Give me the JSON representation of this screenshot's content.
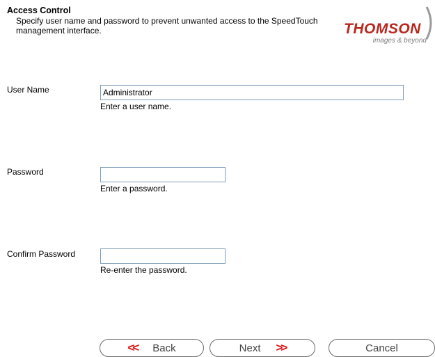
{
  "header": {
    "title": "Access Control",
    "description": "Specify user name and password to prevent unwanted access to the SpeedTouch management interface."
  },
  "logo": {
    "brand": "THOMSON",
    "tagline": "images & beyond",
    "brand_color": "#b8271e"
  },
  "fields": {
    "username": {
      "label": "User Name",
      "value": "Administrator",
      "hint": "Enter a user name."
    },
    "password": {
      "label": "Password",
      "value": "",
      "hint": "Enter a password."
    },
    "confirm": {
      "label": "Confirm Password",
      "value": "",
      "hint": "Re-enter the password."
    }
  },
  "buttons": {
    "back": {
      "label": "Back",
      "arrow": "<<"
    },
    "next": {
      "label": "Next",
      "arrow": ">>"
    },
    "cancel": {
      "label": "Cancel"
    }
  }
}
